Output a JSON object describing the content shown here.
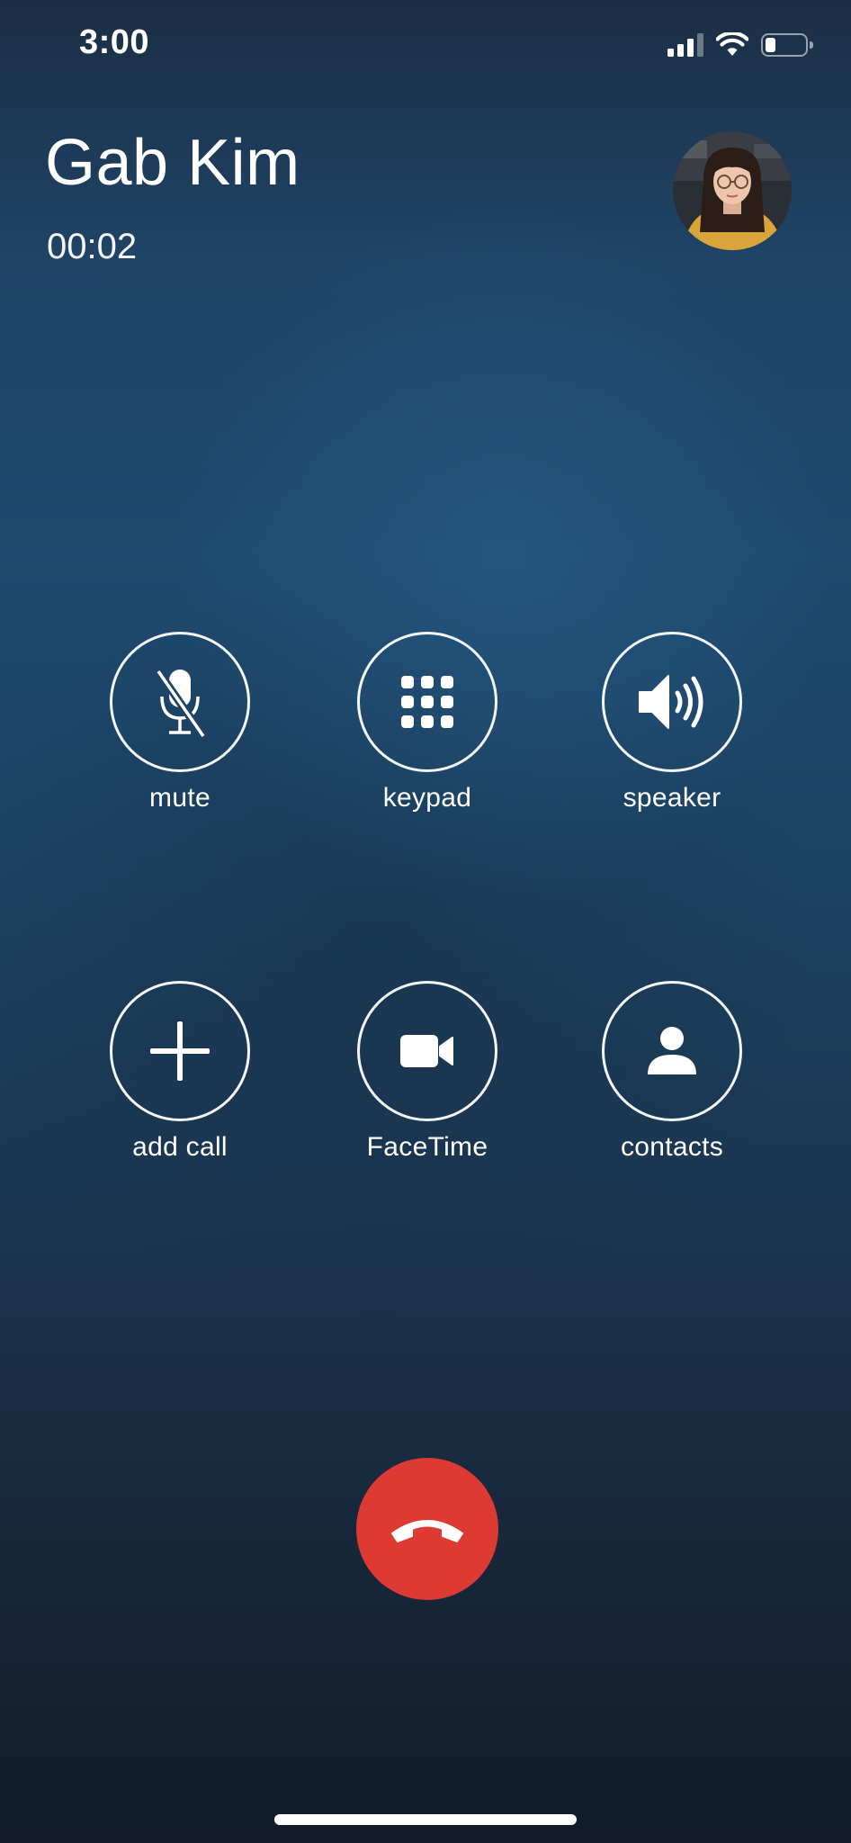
{
  "status_bar": {
    "time": "3:00",
    "icons": [
      "cellular-signal-icon",
      "wifi-icon",
      "battery-icon"
    ]
  },
  "caller": {
    "name": "Gab Kim",
    "duration": "00:02",
    "avatar_icon": "contact-photo"
  },
  "controls": [
    {
      "label": "mute",
      "icon": "microphone-muted-icon"
    },
    {
      "label": "keypad",
      "icon": "keypad-grid-icon"
    },
    {
      "label": "speaker",
      "icon": "speaker-icon"
    },
    {
      "label": "add call",
      "icon": "plus-icon"
    },
    {
      "label": "FaceTime",
      "icon": "video-camera-icon"
    },
    {
      "label": "contacts",
      "icon": "person-icon"
    }
  ],
  "end_call": {
    "icon": "phone-hangup-icon",
    "color": "#dc3a33"
  },
  "colors": {
    "background_top": "#1f4466",
    "background_bottom": "#121c28",
    "foreground": "#ffffff"
  }
}
